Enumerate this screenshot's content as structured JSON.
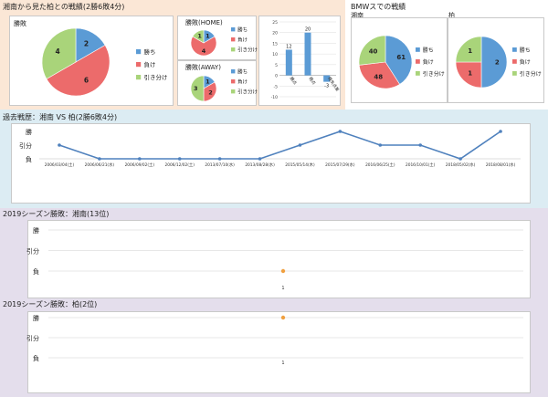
{
  "colors": {
    "win": "#5b9bd5",
    "loss": "#ec6b6b",
    "draw": "#a9d47a",
    "line": "#4f81bd",
    "marker": "#f0a040",
    "panel_peach": "#fbe7d6",
    "panel_blue": "#dcecf3",
    "panel_purple": "#e4deec"
  },
  "sections": {
    "top_left_title": "湘南から見た柏との戦績(2勝6敗4分)",
    "top_right_title": "BMWスでの戦績",
    "history_title": "過去戦歴：湘南 VS 柏(2勝6敗4分)",
    "season_shonan_title": "2019シーズン勝敗：湘南(13位)",
    "season_kashiwa_title": "2019シーズン勝敗：柏(2位)"
  },
  "legend": {
    "win": "勝ち",
    "loss": "負け",
    "draw": "引き分け"
  },
  "chart_data": [
    {
      "id": "overall",
      "type": "pie",
      "title": "勝敗",
      "labels": [
        "勝ち",
        "負け",
        "引き分け"
      ],
      "values": [
        2,
        6,
        4
      ]
    },
    {
      "id": "home",
      "type": "pie",
      "title": "勝敗(HOME)",
      "labels": [
        "勝ち",
        "負け",
        "引き分け"
      ],
      "values": [
        1,
        4,
        1
      ]
    },
    {
      "id": "away",
      "type": "pie",
      "title": "勝敗(AWAY)",
      "labels": [
        "勝ち",
        "負け",
        "引き分け"
      ],
      "values": [
        1,
        2,
        3
      ]
    },
    {
      "id": "goals",
      "type": "bar",
      "categories": [
        "勝点",
        "得点",
        "得失点差"
      ],
      "values": [
        12,
        20,
        -3
      ],
      "ylim": [
        -10,
        25
      ],
      "yticks": [
        -10,
        -5,
        0,
        5,
        10,
        15,
        20,
        25
      ]
    },
    {
      "id": "bmws_shonan",
      "type": "pie",
      "title": "湘南",
      "labels": [
        "勝ち",
        "負け",
        "引き分け"
      ],
      "values": [
        61,
        48,
        40
      ]
    },
    {
      "id": "bmws_kashiwa",
      "type": "pie",
      "title": "柏",
      "labels": [
        "勝ち",
        "負け",
        "引き分け"
      ],
      "values": [
        2,
        1,
        1
      ]
    },
    {
      "id": "history",
      "type": "line",
      "levels": [
        "勝",
        "引分",
        "負"
      ],
      "x": [
        "2006/03/04(土)",
        "2006/06/21(水)",
        "2006/09/02(土)",
        "2006/12/02(土)",
        "2013/07/10(水)",
        "2013/08/28(水)",
        "2015/05/14(木)",
        "2015/07/29(水)",
        "2016/06/25(土)",
        "2016/10/01(土)",
        "2018/05/02(水)",
        "2018/08/01(水)"
      ],
      "y": [
        "引分",
        "負",
        "負",
        "負",
        "負",
        "負",
        "引分",
        "勝",
        "引分",
        "引分",
        "負",
        "勝"
      ]
    },
    {
      "id": "season_shonan",
      "type": "scatter",
      "levels": [
        "勝",
        "引分",
        "負"
      ],
      "x": [
        "1"
      ],
      "y": [
        "負"
      ]
    },
    {
      "id": "season_kashiwa",
      "type": "scatter",
      "levels": [
        "勝",
        "引分",
        "負"
      ],
      "x": [
        "1"
      ],
      "y": [
        "勝"
      ]
    }
  ]
}
